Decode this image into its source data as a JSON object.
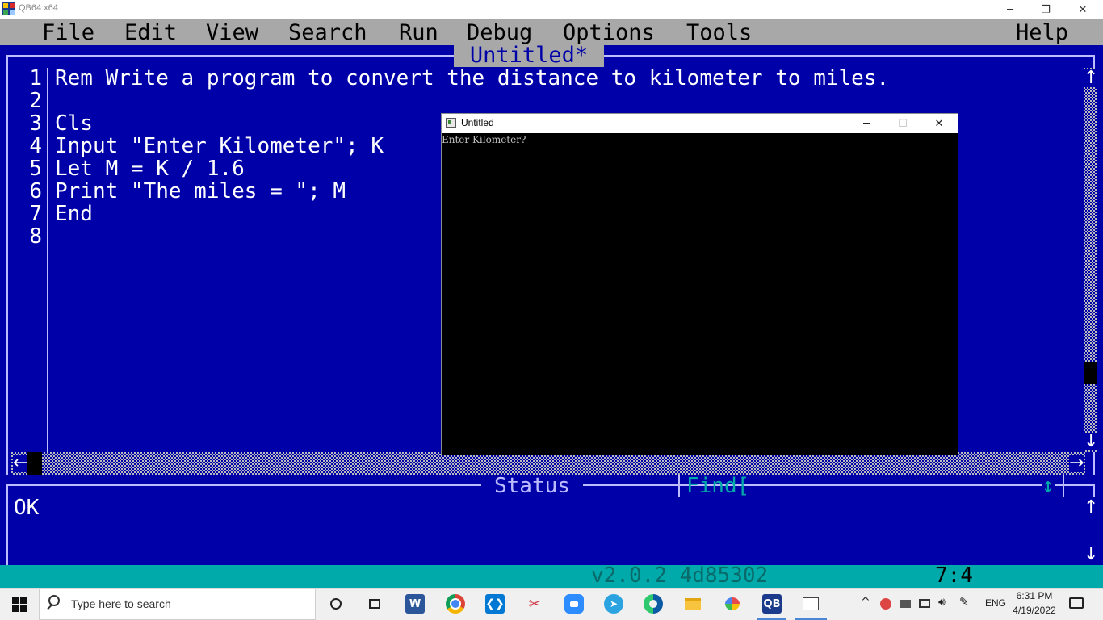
{
  "window": {
    "title": "QB64 x64",
    "minimize_glyph": "─",
    "restore_glyph": "❐",
    "close_glyph": "✕"
  },
  "menu": {
    "file": "File",
    "edit": "Edit",
    "view": "View",
    "search": "Search",
    "run": "Run",
    "debug": "Debug",
    "options": "Options",
    "tools": "Tools",
    "help": "Help"
  },
  "editor": {
    "doc_title": "Untitled*",
    "lines": [
      {
        "num": "1",
        "text": "Rem Write a program to convert the distance to kilometer to miles."
      },
      {
        "num": "2",
        "text": ""
      },
      {
        "num": "3",
        "text": "Cls"
      },
      {
        "num": "4",
        "text": "Input \"Enter Kilometer\"; K"
      },
      {
        "num": "5",
        "text": "Let M = K / 1.6"
      },
      {
        "num": "6",
        "text": "Print \"The miles = \"; M"
      },
      {
        "num": "7",
        "text": "End"
      },
      {
        "num": "8",
        "text": ""
      }
    ],
    "scroll_up": "↑",
    "scroll_down": "↓",
    "scroll_left": "←",
    "scroll_right": "→"
  },
  "status": {
    "label": "Status",
    "find_label": "Find[",
    "find_arrow": "↕",
    "message": "OK",
    "scroll_up": "↑",
    "scroll_down": "↓"
  },
  "infobar": {
    "version": "v2.0.2 4d85302",
    "cursor": "7:4"
  },
  "output_window": {
    "title": "Untitled",
    "text": "Enter Kilometer?",
    "minimize_glyph": "─",
    "maximize_glyph": "☐",
    "close_glyph": "✕"
  },
  "taskbar": {
    "search_placeholder": "Type here to search",
    "tray_chevron": "^",
    "language": "ENG",
    "time": "6:31 PM",
    "date": "4/19/2022",
    "word_label": "W",
    "qb64_label": "QB"
  },
  "colors": {
    "editor_bg": "#0000A8",
    "menu_bg": "#A8A8A8",
    "info_bg": "#00AAAA",
    "find_text": "#00AAAA"
  }
}
